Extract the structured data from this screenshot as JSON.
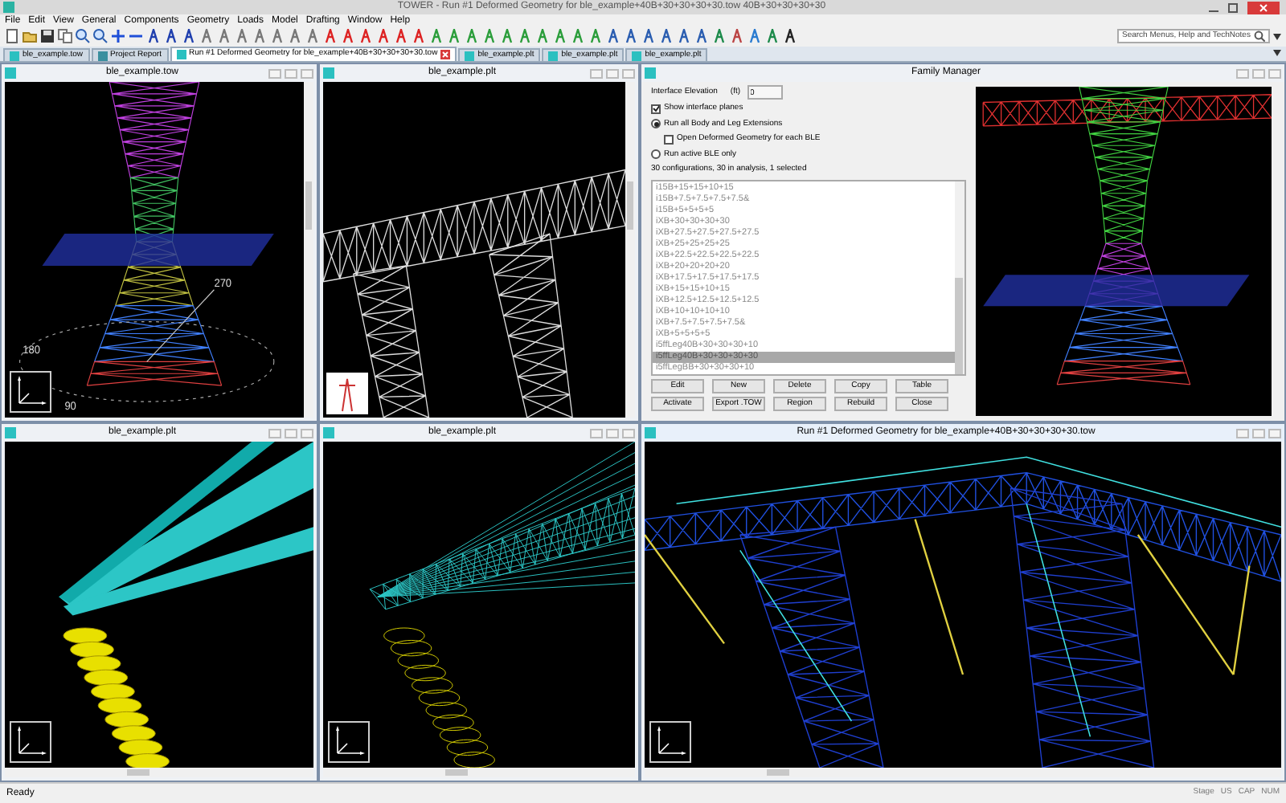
{
  "window": {
    "title": "TOWER - Run #1 Deformed Geometry for ble_example+40B+30+30+30+30.tow  40B+30+30+30+30"
  },
  "menu": [
    "File",
    "Edit",
    "View",
    "General",
    "Components",
    "Geometry",
    "Loads",
    "Model",
    "Drafting",
    "Window",
    "Help"
  ],
  "search": {
    "placeholder": "Search Menus, Help and TechNotes"
  },
  "doc_tabs": [
    {
      "label": "ble_example.tow",
      "selected": false
    },
    {
      "label": "Project Report",
      "selected": false
    },
    {
      "label": "Run #1 Deformed Geometry for ble_example+40B+30+30+30+30.tow",
      "selected": true
    },
    {
      "label": "ble_example.plt",
      "selected": false
    },
    {
      "label": "ble_example.plt",
      "selected": false
    },
    {
      "label": "ble_example.plt",
      "selected": false
    }
  ],
  "views": [
    {
      "title": "ble_example.tow",
      "kind": "tower",
      "compass_labels": [
        "180",
        "270",
        "90"
      ]
    },
    {
      "title": "ble_example.plt",
      "kind": "wire"
    },
    {
      "title": "ble_example.plt",
      "kind": "insulator"
    },
    {
      "title": "ble_example.plt",
      "kind": "wire_insulator"
    },
    {
      "title": "Run #1 Deformed Geometry for ble_example+40B+30+30+30+30.tow",
      "kind": "deformed"
    }
  ],
  "family_manager": {
    "title": "Family Manager",
    "elevation_label": "Interface Elevation",
    "elevation_unit": "(ft)",
    "elevation_value": "0",
    "options": [
      {
        "kind": "checkbox",
        "label": "Show interface planes",
        "checked": true
      },
      {
        "kind": "radio",
        "label": "Run all Body and Leg Extensions",
        "checked": true
      },
      {
        "kind": "subcheckbox",
        "label": "Open Deformed Geometry for each BLE",
        "checked": false
      },
      {
        "kind": "radio",
        "label": "Run active BLE only",
        "checked": false
      }
    ],
    "summary": "30 configurations, 30 in analysis, 1 selected",
    "list": [
      {
        "label": "i15B+15+15+10+15",
        "selected": false
      },
      {
        "label": "i15B+7.5+7.5+7.5+7.5&",
        "selected": false
      },
      {
        "label": "i15B+5+5+5+5",
        "selected": false
      },
      {
        "label": "iXB+30+30+30+30",
        "selected": false
      },
      {
        "label": "iXB+27.5+27.5+27.5+27.5",
        "selected": false
      },
      {
        "label": "iXB+25+25+25+25",
        "selected": false
      },
      {
        "label": "iXB+22.5+22.5+22.5+22.5",
        "selected": false
      },
      {
        "label": "iXB+20+20+20+20",
        "selected": false
      },
      {
        "label": "iXB+17.5+17.5+17.5+17.5",
        "selected": false
      },
      {
        "label": "iXB+15+15+10+15",
        "selected": false
      },
      {
        "label": "iXB+12.5+12.5+12.5+12.5",
        "selected": false
      },
      {
        "label": "iXB+10+10+10+10",
        "selected": false
      },
      {
        "label": "iXB+7.5+7.5+7.5+7.5&",
        "selected": false
      },
      {
        "label": "iXB+5+5+5+5",
        "selected": false
      },
      {
        "label": "i5ffLeg40B+30+30+30+10",
        "selected": false
      },
      {
        "label": "i5ffLeg40B+30+30+30+30",
        "selected": true
      },
      {
        "label": "i5ffLegBB+30+30+30+10",
        "selected": false
      }
    ],
    "buttons": [
      [
        "Edit",
        "New",
        "Delete",
        "Copy",
        "Table"
      ],
      [
        "Activate",
        "Export .TOW",
        "Region",
        "Rebuild",
        "Close"
      ]
    ]
  },
  "status_bar": {
    "text": "Ready",
    "indicators": [
      "Stage",
      "US",
      "CAP",
      "NUM"
    ]
  }
}
